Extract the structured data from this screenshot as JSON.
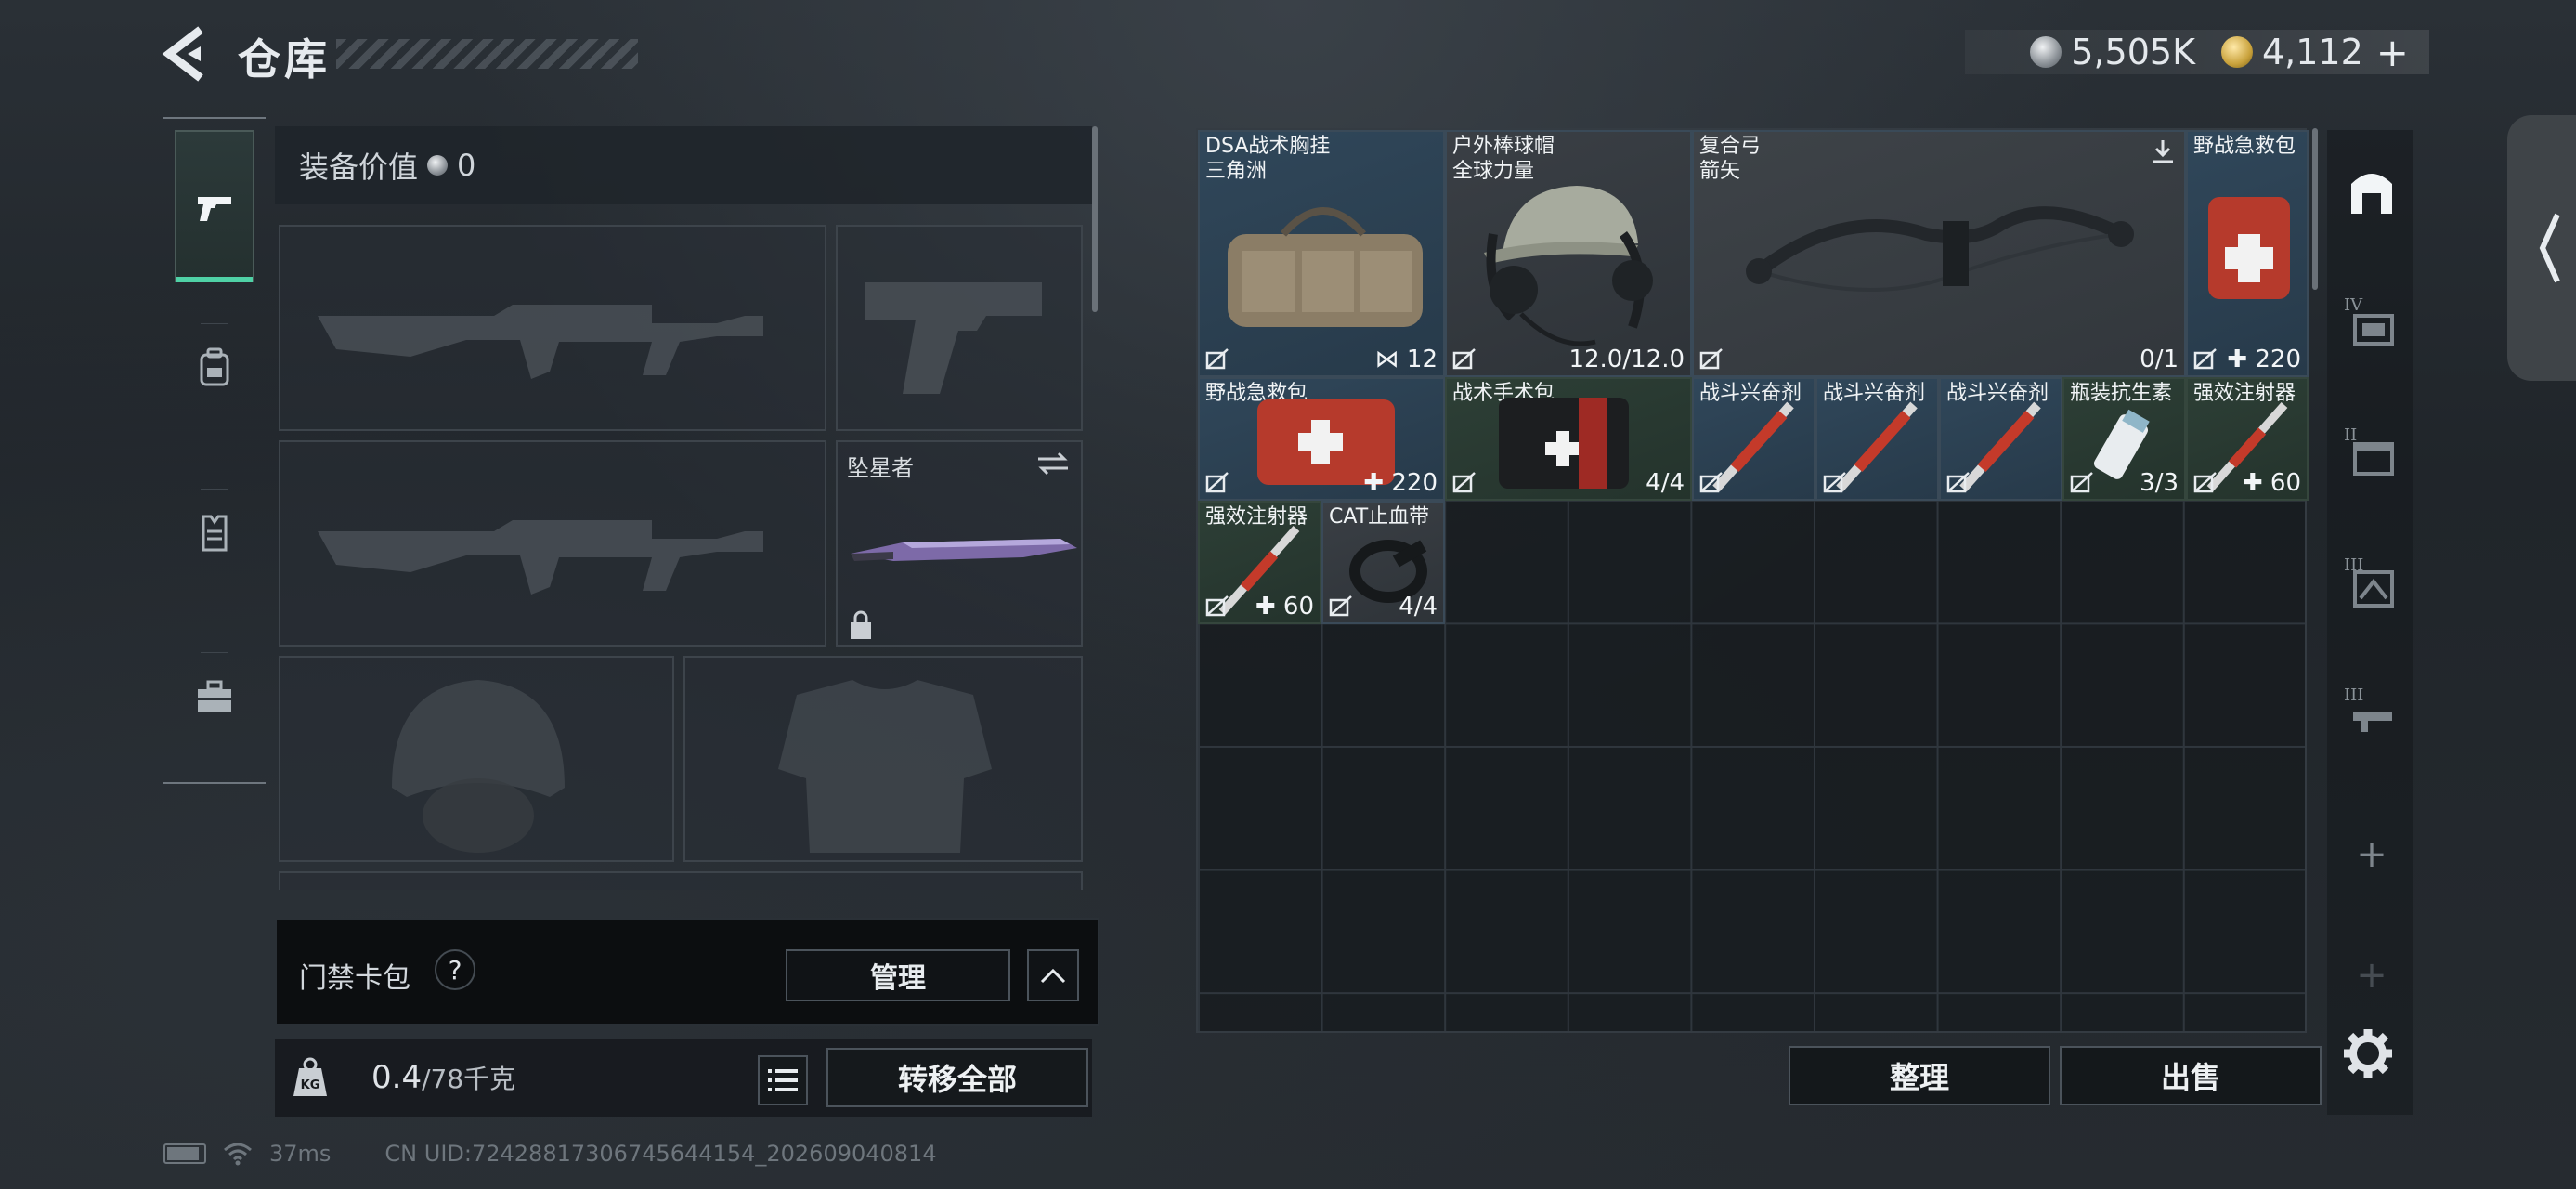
{
  "header": {
    "title": "仓库",
    "currency": [
      {
        "icon": "silver-coin-icon",
        "value": "5,505K"
      },
      {
        "icon": "gold-coin-icon",
        "value": "4,112"
      }
    ],
    "add_label": "+"
  },
  "loadout": {
    "value_label": "装备价值",
    "value_amount": "0",
    "melee_slot_label": "坠星者"
  },
  "keycard": {
    "label": "门禁卡包",
    "help": "?",
    "manage_label": "管理"
  },
  "weight": {
    "current": "0.4",
    "capacity": "/78千克",
    "kg_label": "KG",
    "transfer_all_label": "转移全部"
  },
  "stash": {
    "items": [
      {
        "name": "DSA战术胸挂\n三角洲",
        "count": "12",
        "color": "blue"
      },
      {
        "name": "户外棒球帽\n全球力量",
        "count": "12.0/12.0",
        "color": "grey"
      },
      {
        "name": "复合弓\n箭矢",
        "count": "0/1",
        "color": "grey"
      },
      {
        "name": "野战急救包",
        "count": "220",
        "color": "blue"
      },
      {
        "name": "野战急救包",
        "count": "220",
        "color": "blue"
      },
      {
        "name": "战术手术包",
        "count": "4/4",
        "color": "green"
      },
      {
        "name": "战斗兴奋剂",
        "count": "",
        "color": "blue"
      },
      {
        "name": "战斗兴奋剂",
        "count": "",
        "color": "blue"
      },
      {
        "name": "战斗兴奋剂",
        "count": "",
        "color": "blue"
      },
      {
        "name": "瓶装抗生素",
        "count": "3/3",
        "color": "green"
      },
      {
        "name": "强效注射器",
        "count": "60",
        "color": "green"
      },
      {
        "name": "强效注射器",
        "count": "60",
        "color": "green"
      },
      {
        "name": "CAT止血带",
        "count": "4/4",
        "color": "grey"
      }
    ],
    "sort_label": "整理",
    "sell_label": "出售"
  },
  "right_tabs": {
    "numerals": [
      "IV",
      "II",
      "III",
      "III"
    ],
    "add_label": "+"
  },
  "status_bar": {
    "ping": "37ms",
    "uid": "CN UID:7242881730674564415​4_202609040814"
  },
  "colors": {
    "accent_green": "#4fd1a6",
    "item_blue": "#30475a",
    "item_green": "#2d3f36",
    "item_grey": "#3a3f45"
  }
}
